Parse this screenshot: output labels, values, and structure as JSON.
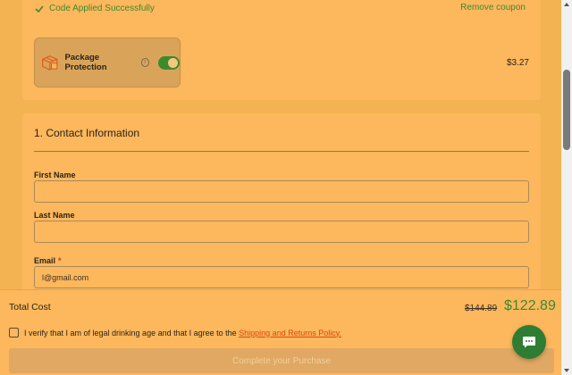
{
  "coupon": {
    "applied_text": "Code Applied Successfully",
    "remove_label": "Remove coupon"
  },
  "protection": {
    "label": "Package Protection",
    "info_glyph": "i",
    "enabled": true,
    "price": "$3.27"
  },
  "contact": {
    "title": "1. Contact Information",
    "first_name": {
      "label": "First Name",
      "value": ""
    },
    "last_name": {
      "label": "Last Name",
      "value": ""
    },
    "email": {
      "label": "Email",
      "required_mark": "*",
      "value": "l@gmail.com"
    }
  },
  "footer": {
    "total_label": "Total Cost",
    "original_price": "$144.89",
    "discounted_price": "$122.89",
    "verify_text": "I verify that I am of legal drinking age and that I agree to the ",
    "policy_link": "Shipping and Returns Policy.",
    "purchase_label": "Complete your Purchase"
  },
  "colors": {
    "accent_green": "#3c8a2e",
    "page_bg": "#f4b352",
    "link_orange": "#d9480f",
    "chat_green": "#2e7d32"
  },
  "icons": [
    "check-icon",
    "package-box-icon",
    "info-icon",
    "chat-icon"
  ]
}
